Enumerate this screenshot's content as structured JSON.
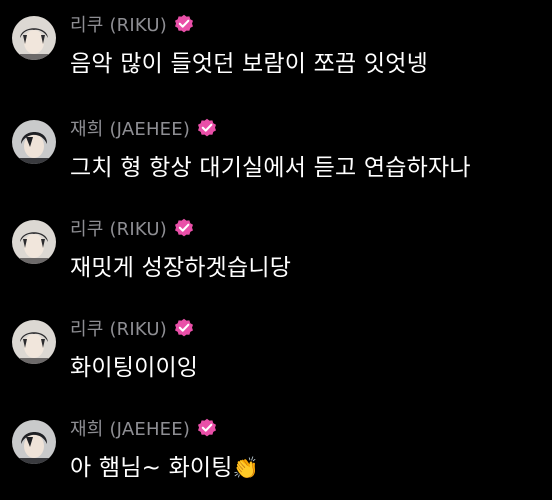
{
  "colors": {
    "background": "#000000",
    "sender": "#8e8e93",
    "message": "#ffffff",
    "verified_badge": "#e94fa8"
  },
  "icons": {
    "verified": "verified-badge-icon",
    "clap": "clapping-hands-icon"
  },
  "messages": [
    {
      "sender": "리쿠 (RIKU)",
      "avatar": "riku-avatar",
      "text": "음악 많이 들엇던 보람이 쪼끔 잇엇넹"
    },
    {
      "sender": "재희 (JAEHEE)",
      "avatar": "jaehee-avatar",
      "text": "그치 형 항상 대기실에서 듣고 연습하자나"
    },
    {
      "sender": "리쿠 (RIKU)",
      "avatar": "riku-avatar",
      "text": "재밋게 성장하겟습니당"
    },
    {
      "sender": "리쿠 (RIKU)",
      "avatar": "riku-avatar",
      "text": "화이팅이이잉"
    },
    {
      "sender": "재희 (JAEHEE)",
      "avatar": "jaehee-avatar",
      "text": "아 햄님~ 화이팅",
      "emoji": "👏"
    }
  ]
}
